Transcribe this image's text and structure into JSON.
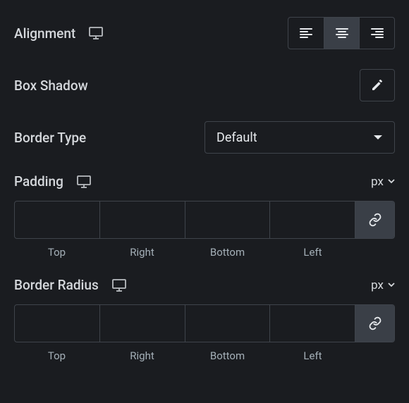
{
  "alignment": {
    "label": "Alignment",
    "selected": "center"
  },
  "boxShadow": {
    "label": "Box Shadow"
  },
  "borderType": {
    "label": "Border Type",
    "value": "Default"
  },
  "padding": {
    "label": "Padding",
    "unit": "px",
    "sides": {
      "top": "Top",
      "right": "Right",
      "bottom": "Bottom",
      "left": "Left"
    },
    "values": {
      "top": "",
      "right": "",
      "bottom": "",
      "left": ""
    }
  },
  "borderRadius": {
    "label": "Border Radius",
    "unit": "px",
    "sides": {
      "top": "Top",
      "right": "Right",
      "bottom": "Bottom",
      "left": "Left"
    },
    "values": {
      "top": "",
      "right": "",
      "bottom": "",
      "left": ""
    }
  }
}
